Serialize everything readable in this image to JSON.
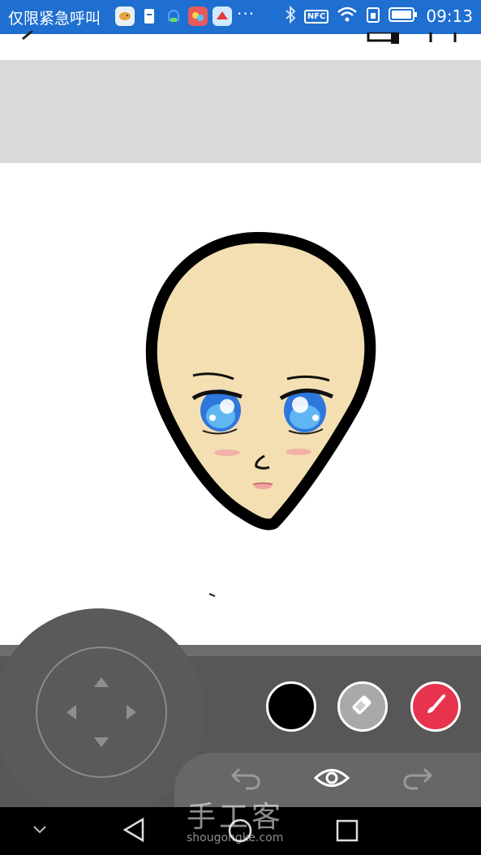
{
  "status_bar": {
    "carrier_text": "仅限紧急呼叫",
    "more_indicator": "···",
    "nfc_label": "NFC",
    "time": "09:13",
    "icons": [
      "fish-app-icon",
      "battery-app-icon",
      "cloud-app-icon",
      "game-app-icon",
      "huawei-app-icon",
      "bluetooth-icon",
      "nfc-icon",
      "wifi-icon",
      "sim-icon",
      "battery-icon"
    ]
  },
  "toolbar": {
    "icons": [
      "back-icon",
      "layers-icon",
      "expand-icon"
    ]
  },
  "drawing_tools": {
    "color_swatch": "#000000",
    "eraser_icon": "eraser-icon",
    "brush_color": "#e8334f",
    "brush_icon": "brush-icon"
  },
  "history_bar": {
    "icons": [
      "undo-icon",
      "eye-icon",
      "redo-icon"
    ]
  },
  "watermark": {
    "main": "手工客",
    "sub": "shougongke.com"
  },
  "colors": {
    "status_bar": "#1f6fd0",
    "panel": "#575757",
    "skin": "#f3dfb2",
    "eye_blue": "#2f76dd"
  }
}
